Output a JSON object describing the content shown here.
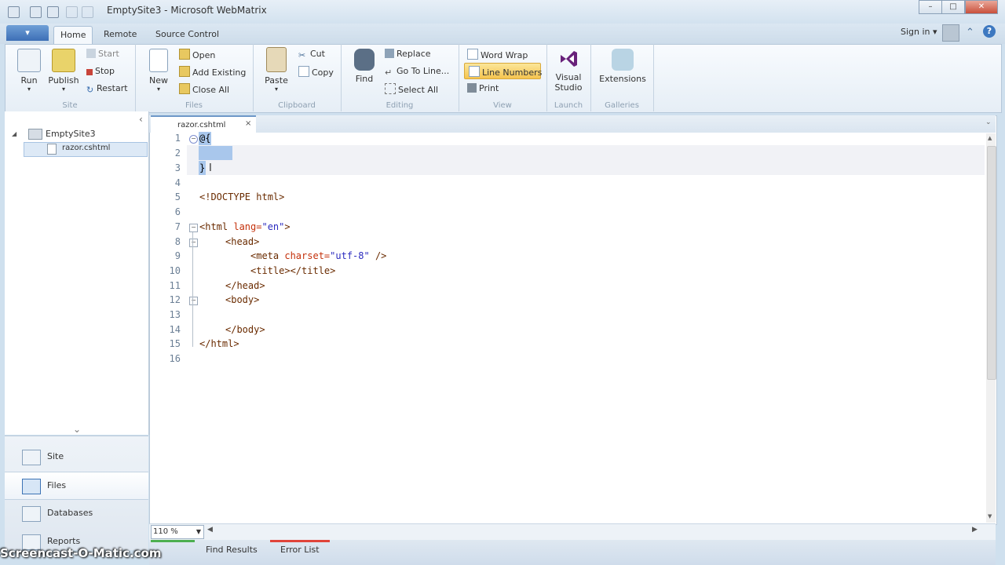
{
  "window": {
    "title": "EmptySite3 - Microsoft WebMatrix",
    "controls": {
      "minimize": "–",
      "maximize": "□",
      "close": "✕"
    }
  },
  "ribbon_tabs": {
    "file": "",
    "tabs": [
      "Home",
      "Remote",
      "Source Control"
    ],
    "active": "Home",
    "sign_in": "Sign in",
    "up_icon": "⌃",
    "help_icon": "?"
  },
  "ribbon": {
    "site": {
      "run": "Run",
      "publish": "Publish",
      "start": "Start",
      "stop": "Stop",
      "restart": "Restart",
      "label": "Site"
    },
    "files": {
      "new": "New",
      "open": "Open",
      "add_existing": "Add Existing",
      "close_all": "Close All",
      "label": "Files"
    },
    "clipboard": {
      "paste": "Paste",
      "cut": "Cut",
      "copy": "Copy",
      "label": "Clipboard"
    },
    "editing": {
      "find": "Find",
      "replace": "Replace",
      "go_to_line": "Go To Line...",
      "select_all": "Select All",
      "label": "Editing"
    },
    "view": {
      "word_wrap": "Word Wrap",
      "line_numbers": "Line Numbers",
      "print": "Print",
      "label": "View"
    },
    "launch": {
      "visual_studio_1": "Visual",
      "visual_studio_2": "Studio",
      "label": "Launch"
    },
    "galleries": {
      "extensions": "Extensions",
      "label": "Galleries"
    }
  },
  "tree": {
    "root": "EmptySite3",
    "file": "razor.cshtml",
    "collapse_glyph": "‹",
    "expand_glyph": "◢"
  },
  "nav": {
    "items": [
      "Site",
      "Files",
      "Databases",
      "Reports"
    ],
    "chevron": "⌄"
  },
  "editor": {
    "tab_label": "razor.cshtml",
    "tab_close": "×",
    "lines": [
      "1",
      "2",
      "3",
      "4",
      "5",
      "6",
      "7",
      "8",
      "9",
      "10",
      "11",
      "12",
      "13",
      "14",
      "15",
      "16"
    ],
    "code": {
      "l1": "@{",
      "l3": "}",
      "l5": "<!DOCTYPE html>",
      "l7a": "<html",
      "l7b": " lang=",
      "l7c": "\"en\"",
      "l7d": ">",
      "l8": "<head>",
      "l9a": "<meta",
      "l9b": " charset=",
      "l9c": "\"utf-8\"",
      "l9d": " />",
      "l10": "<title></title>",
      "l11": "</head>",
      "l12": "<body>",
      "l14": "</body>",
      "l15": "</html>"
    }
  },
  "status": {
    "zoom": "110 %"
  },
  "bottom_tabs": [
    "Find Results",
    "Error List"
  ],
  "watermark": "Screencast-O-Matic.com"
}
